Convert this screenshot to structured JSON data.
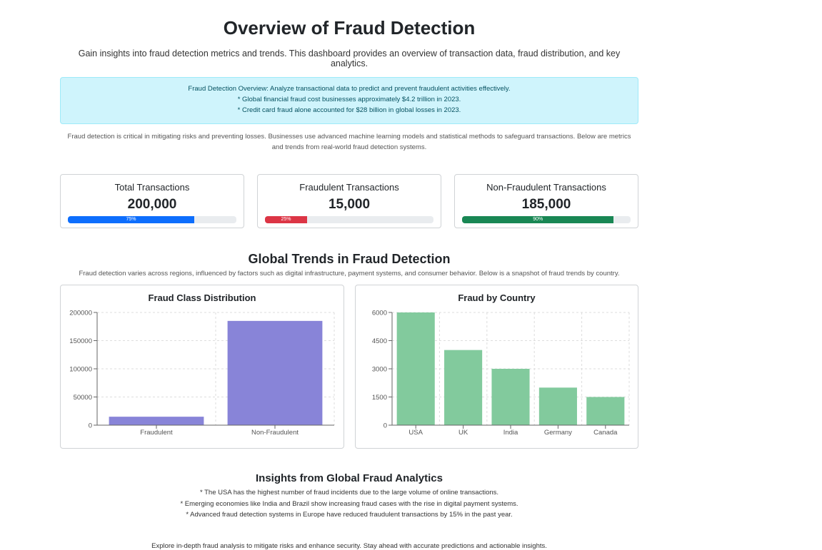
{
  "header": {
    "title": "Overview of Fraud Detection",
    "subtitle": "Gain insights into fraud detection metrics and trends. This dashboard provides an overview of transaction data, fraud distribution, and key analytics."
  },
  "alert": {
    "line1": "Fraud Detection Overview: Analyze transactional data to predict and prevent fraudulent activities effectively.",
    "line2": "* Global financial fraud cost businesses approximately $4.2 trillion in 2023.",
    "line3": "* Credit card fraud alone accounted for $28 billion in global losses in 2023."
  },
  "intro": "Fraud detection is critical in mitigating risks and preventing losses. Businesses use advanced machine learning models and statistical methods to safeguard transactions. Below are metrics and trends from real-world fraud detection systems.",
  "cards": [
    {
      "title": "Total Transactions",
      "value": "200,000",
      "progress": 75,
      "progress_label": "75%",
      "color": "#0d6efd"
    },
    {
      "title": "Fraudulent Transactions",
      "value": "15,000",
      "progress": 25,
      "progress_label": "25%",
      "color": "#dc3545"
    },
    {
      "title": "Non-Fraudulent Transactions",
      "value": "185,000",
      "progress": 90,
      "progress_label": "90%",
      "color": "#198754"
    }
  ],
  "trends": {
    "title": "Global Trends in Fraud Detection",
    "description": "Fraud detection varies across regions, influenced by factors such as digital infrastructure, payment systems, and consumer behavior. Below is a snapshot of fraud trends by country."
  },
  "chart_data": [
    {
      "type": "bar",
      "title": "Fraud Class Distribution",
      "categories": [
        "Fraudulent",
        "Non-Fraudulent"
      ],
      "values": [
        15000,
        185000
      ],
      "ylim": [
        0,
        200000
      ],
      "yticks": [
        0,
        50000,
        100000,
        150000,
        200000
      ],
      "color": "#8884d8",
      "grid": true
    },
    {
      "type": "bar",
      "title": "Fraud by Country",
      "categories": [
        "USA",
        "UK",
        "India",
        "Germany",
        "Canada"
      ],
      "values": [
        6000,
        4000,
        3000,
        2000,
        1500
      ],
      "ylim": [
        0,
        6000
      ],
      "yticks": [
        0,
        1500,
        3000,
        4500,
        6000
      ],
      "color": "#82ca9d",
      "grid": true
    }
  ],
  "insights": {
    "title": "Insights from Global Fraud Analytics",
    "items": [
      "* The USA has the highest number of fraud incidents due to the large volume of online transactions.",
      "* Emerging economies like India and Brazil show increasing fraud cases with the rise in digital payment systems.",
      "* Advanced fraud detection systems in Europe have reduced fraudulent transactions by 15% in the past year."
    ]
  },
  "footer": "Explore in-depth fraud analysis to mitigate risks and enhance security. Stay ahead with accurate predictions and actionable insights."
}
